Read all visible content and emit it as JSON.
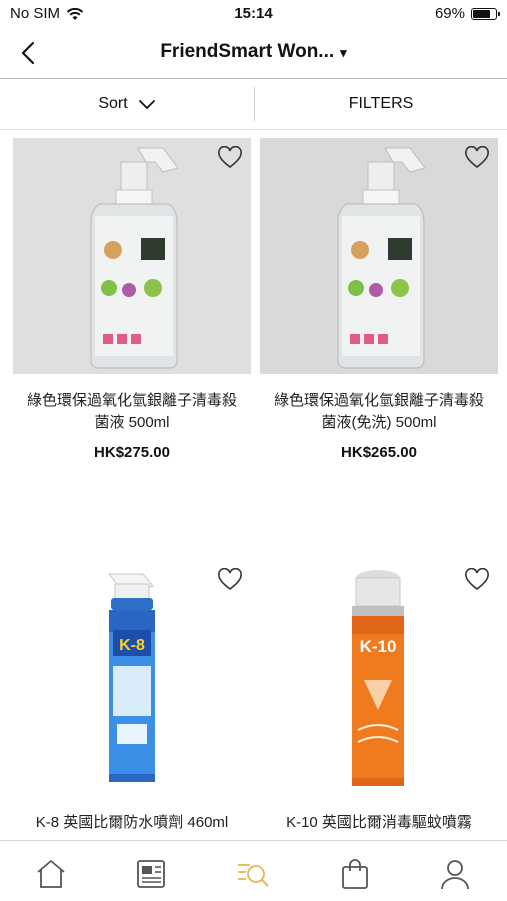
{
  "status": {
    "carrier": "No SIM",
    "time": "15:14",
    "battery": "69%",
    "battery_level": 0.69
  },
  "nav": {
    "title": "FriendSmart Won...",
    "caret": "▾"
  },
  "filterbar": {
    "sort_label": "Sort",
    "filters_label": "FILTERS"
  },
  "products": [
    {
      "name_line1": "綠色環保過氧化氫銀離子清毒殺",
      "name_line2": "菌液 500ml",
      "price": "HK$275.00"
    },
    {
      "name_line1": "綠色環保過氧化氫銀離子清毒殺",
      "name_line2": "菌液(免洗) 500ml",
      "price": "HK$265.00"
    },
    {
      "name_line1": "K-8 英國比爾防水噴劑 460ml",
      "label": "K-8"
    },
    {
      "name_line1": "K-10 英國比爾消毒驅蚊噴霧",
      "label": "K-10"
    }
  ],
  "tabbar": {
    "items": [
      "home-icon",
      "news-icon",
      "search-list-icon",
      "bag-icon",
      "profile-icon"
    ],
    "active_color": "#e8b84b"
  }
}
